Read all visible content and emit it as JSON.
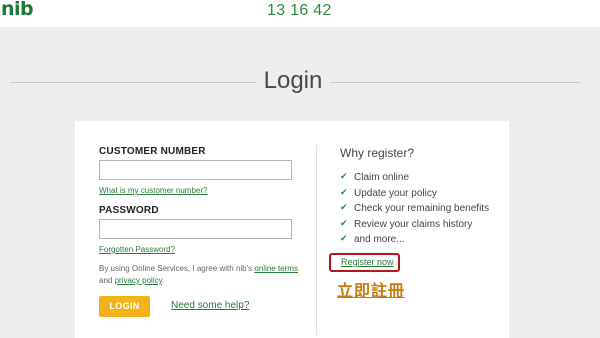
{
  "header": {
    "logo_text": "nib",
    "phone": "13 16 42",
    "brand_color": "#1a7a36"
  },
  "page": {
    "title": "Login"
  },
  "login_form": {
    "customer_number_label": "CUSTOMER NUMBER",
    "customer_number_value": "",
    "customer_number_help": "What is my customer number?",
    "password_label": "PASSWORD",
    "password_value": "",
    "forgot_password": "Forgotten Password?",
    "terms_prefix": "By using Online Services, I agree with nib's",
    "terms_link": "online terms",
    "terms_and": "and",
    "privacy_link": "privacy policy",
    "terms_suffix": ".",
    "login_button": "LOGIN",
    "help_link": "Need some help?",
    "button_color": "#f3b21a"
  },
  "register": {
    "heading": "Why register?",
    "benefits": [
      "Claim online",
      "Update your policy",
      "Check your remaining benefits",
      "Review your claims history",
      "and more..."
    ],
    "register_link": "Register now",
    "register_annotation": "立即註冊",
    "highlight_color": "#b3161b",
    "annotation_color": "#c47a0e"
  }
}
